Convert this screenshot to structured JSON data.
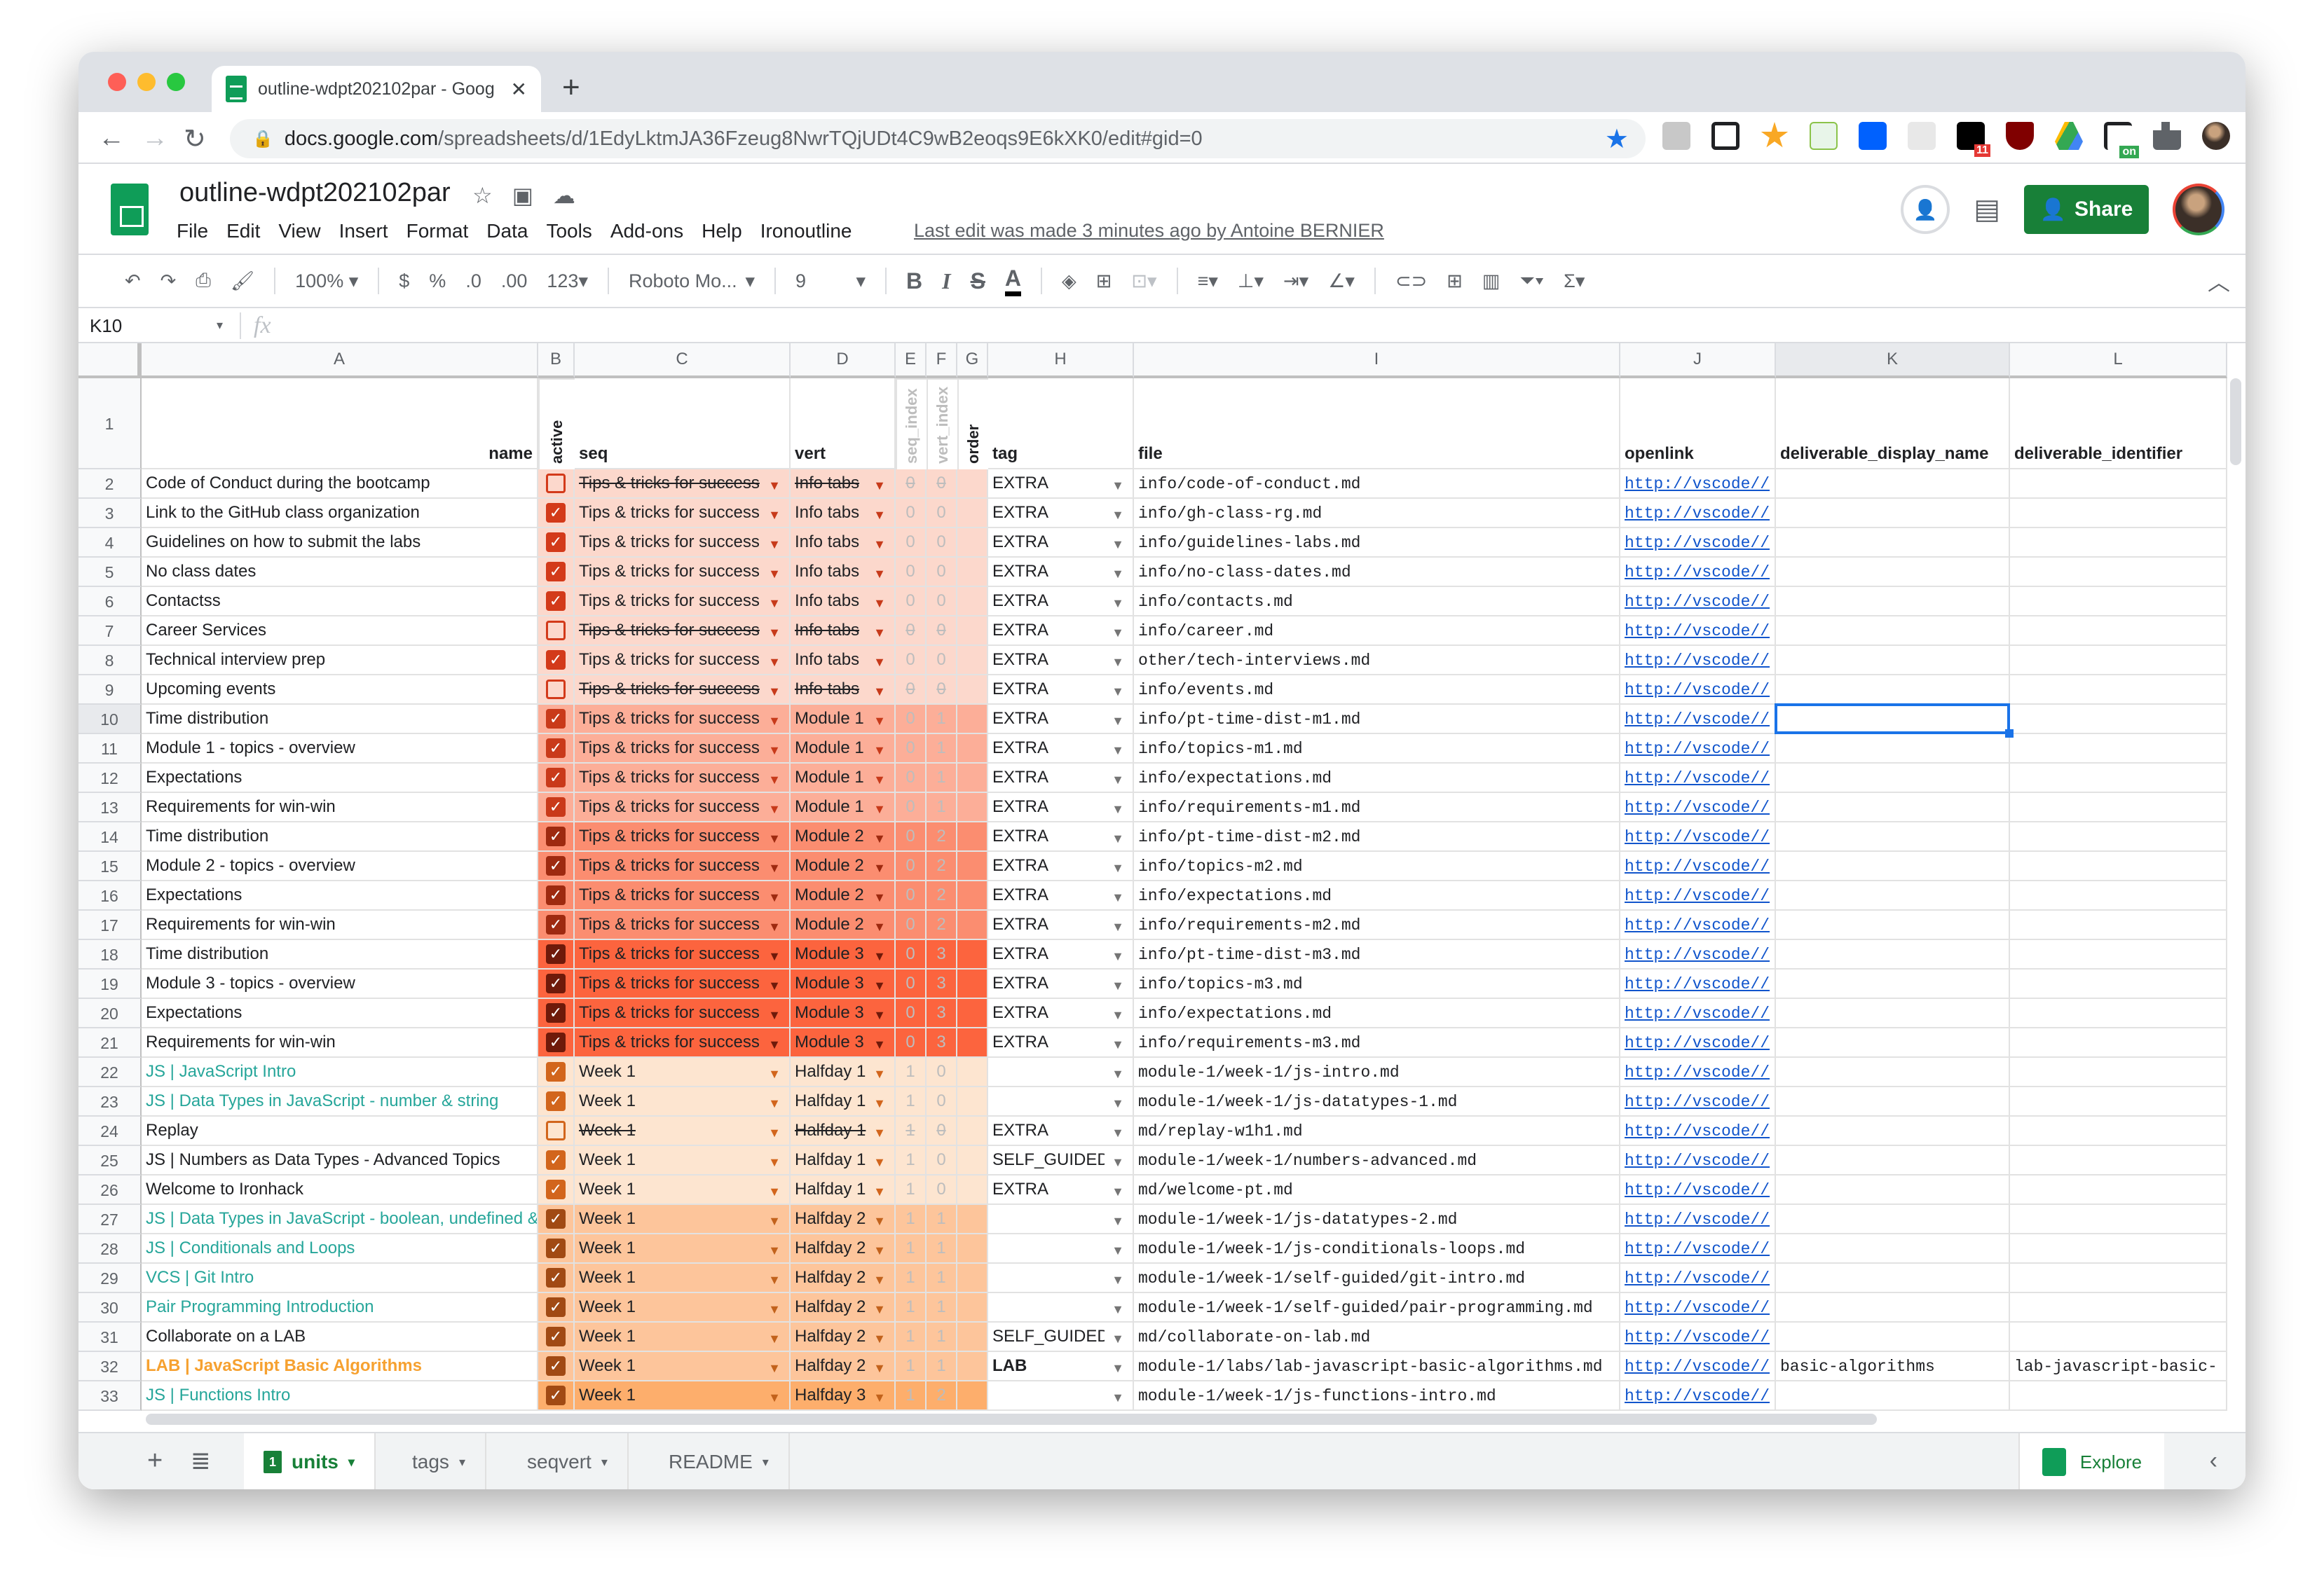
{
  "browser": {
    "tab_title": "outline-wdpt202102par - Goog",
    "url_domain": "docs.google.com",
    "url_path": "/spreadsheets/d/1EdyLktmJA36Fzeug8NwrTQjUDt4C9wB2eoqs9E6kXK0/edit#gid=0",
    "extension_badges": [
      "11",
      "on"
    ]
  },
  "doc": {
    "title": "outline-wdpt202102par",
    "menu": [
      "File",
      "Edit",
      "View",
      "Insert",
      "Format",
      "Data",
      "Tools",
      "Add-ons",
      "Help",
      "Ironoutline"
    ],
    "last_edit": "Last edit was made 3 minutes ago by Antoine BERNIER",
    "share_label": "Share"
  },
  "toolbar": {
    "zoom": "100%",
    "currency": "$",
    "percent": "%",
    "dec_decrease": ".0",
    "dec_increase": ".00",
    "more_formats": "123",
    "font": "Roboto Mo...",
    "font_size": "9"
  },
  "formula_bar": {
    "cell_ref": "K10",
    "fx": "fx",
    "value": ""
  },
  "columns": [
    "A",
    "B",
    "C",
    "D",
    "E",
    "F",
    "G",
    "H",
    "I",
    "J",
    "K",
    "L"
  ],
  "headers": {
    "name": "name",
    "active": "active",
    "seq": "seq",
    "vert": "vert",
    "seq_index": "seq_index",
    "vert_index": "vert_index",
    "order": "order",
    "tag": "tag",
    "file": "file",
    "openlink": "openlink",
    "deliverable_display_name": "deliverable_display_name",
    "deliverable_identifier": "deliverable_identifier"
  },
  "rows": [
    {
      "n": 2,
      "name": "Code of Conduct during the bootcamp",
      "active": false,
      "seq": "Tips & tricks for success",
      "vert": "Info tabs",
      "si": "0",
      "vi": "0",
      "tag": "EXTRA",
      "file": "info/code-of-conduct.md",
      "link": "http://vscode//",
      "band": "t0",
      "nc": "#202124"
    },
    {
      "n": 3,
      "name": "Link to  the GitHub class organization",
      "active": true,
      "seq": "Tips & tricks for success",
      "vert": "Info tabs",
      "si": "0",
      "vi": "0",
      "tag": "EXTRA",
      "file": "info/gh-class-rg.md",
      "link": "http://vscode//",
      "band": "t0",
      "nc": "#202124"
    },
    {
      "n": 4,
      "name": "Guidelines on how to submit the labs",
      "active": true,
      "seq": "Tips & tricks for success",
      "vert": "Info tabs",
      "si": "0",
      "vi": "0",
      "tag": "EXTRA",
      "file": "info/guidelines-labs.md",
      "link": "http://vscode//",
      "band": "t0",
      "nc": "#202124"
    },
    {
      "n": 5,
      "name": "No class dates",
      "active": true,
      "seq": "Tips & tricks for success",
      "vert": "Info tabs",
      "si": "0",
      "vi": "0",
      "tag": "EXTRA",
      "file": "info/no-class-dates.md",
      "link": "http://vscode//",
      "band": "t0",
      "nc": "#202124"
    },
    {
      "n": 6,
      "name": "Contactss",
      "active": true,
      "seq": "Tips & tricks for success",
      "vert": "Info tabs",
      "si": "0",
      "vi": "0",
      "tag": "EXTRA",
      "file": "info/contacts.md",
      "link": "http://vscode//",
      "band": "t0",
      "nc": "#202124"
    },
    {
      "n": 7,
      "name": "Career Services",
      "active": false,
      "seq": "Tips & tricks for success",
      "vert": "Info tabs",
      "si": "0",
      "vi": "0",
      "tag": "EXTRA",
      "file": "info/career.md",
      "link": "http://vscode//",
      "band": "t0",
      "nc": "#202124"
    },
    {
      "n": 8,
      "name": "Technical interview prep",
      "active": true,
      "seq": "Tips & tricks for success",
      "vert": "Info tabs",
      "si": "0",
      "vi": "0",
      "tag": "EXTRA",
      "file": "other/tech-interviews.md",
      "link": "http://vscode//",
      "band": "t0",
      "nc": "#202124"
    },
    {
      "n": 9,
      "name": "Upcoming events",
      "active": false,
      "seq": "Tips & tricks for success",
      "vert": "Info tabs",
      "si": "0",
      "vi": "0",
      "tag": "EXTRA",
      "file": "info/events.md",
      "link": "http://vscode//",
      "band": "t0",
      "nc": "#202124"
    },
    {
      "n": 10,
      "name": "Time distribution",
      "active": true,
      "seq": "Tips & tricks for success",
      "vert": "Module 1",
      "si": "0",
      "vi": "1",
      "tag": "EXTRA",
      "file": "info/pt-time-dist-m1.md",
      "link": "http://vscode//",
      "band": "t1",
      "nc": "#202124"
    },
    {
      "n": 11,
      "name": "Module 1 - topics - overview",
      "active": true,
      "seq": "Tips & tricks for success",
      "vert": "Module 1",
      "si": "0",
      "vi": "1",
      "tag": "EXTRA",
      "file": "info/topics-m1.md",
      "link": "http://vscode//",
      "band": "t1",
      "nc": "#202124"
    },
    {
      "n": 12,
      "name": "Expectations",
      "active": true,
      "seq": "Tips & tricks for success",
      "vert": "Module 1",
      "si": "0",
      "vi": "1",
      "tag": "EXTRA",
      "file": "info/expectations.md",
      "link": "http://vscode//",
      "band": "t1",
      "nc": "#202124"
    },
    {
      "n": 13,
      "name": "Requirements for win-win",
      "active": true,
      "seq": "Tips & tricks for success",
      "vert": "Module 1",
      "si": "0",
      "vi": "1",
      "tag": "EXTRA",
      "file": "info/requirements-m1.md",
      "link": "http://vscode//",
      "band": "t1",
      "nc": "#202124"
    },
    {
      "n": 14,
      "name": "Time distribution",
      "active": true,
      "seq": "Tips & tricks for success",
      "vert": "Module 2",
      "si": "0",
      "vi": "2",
      "tag": "EXTRA",
      "file": "info/pt-time-dist-m2.md",
      "link": "http://vscode//",
      "band": "t2",
      "nc": "#202124"
    },
    {
      "n": 15,
      "name": "Module 2 - topics - overview",
      "active": true,
      "seq": "Tips & tricks for success",
      "vert": "Module 2",
      "si": "0",
      "vi": "2",
      "tag": "EXTRA",
      "file": "info/topics-m2.md",
      "link": "http://vscode//",
      "band": "t2",
      "nc": "#202124"
    },
    {
      "n": 16,
      "name": "Expectations",
      "active": true,
      "seq": "Tips & tricks for success",
      "vert": "Module 2",
      "si": "0",
      "vi": "2",
      "tag": "EXTRA",
      "file": "info/expectations.md",
      "link": "http://vscode//",
      "band": "t2",
      "nc": "#202124"
    },
    {
      "n": 17,
      "name": "Requirements for win-win",
      "active": true,
      "seq": "Tips & tricks for success",
      "vert": "Module 2",
      "si": "0",
      "vi": "2",
      "tag": "EXTRA",
      "file": "info/requirements-m2.md",
      "link": "http://vscode//",
      "band": "t2",
      "nc": "#202124"
    },
    {
      "n": 18,
      "name": "Time distribution",
      "active": true,
      "seq": "Tips & tricks for success",
      "vert": "Module 3",
      "si": "0",
      "vi": "3",
      "tag": "EXTRA",
      "file": "info/pt-time-dist-m3.md",
      "link": "http://vscode//",
      "band": "t3",
      "nc": "#202124"
    },
    {
      "n": 19,
      "name": "Module 3 - topics - overview",
      "active": true,
      "seq": "Tips & tricks for success",
      "vert": "Module 3",
      "si": "0",
      "vi": "3",
      "tag": "EXTRA",
      "file": "info/topics-m3.md",
      "link": "http://vscode//",
      "band": "t3",
      "nc": "#202124"
    },
    {
      "n": 20,
      "name": "Expectations",
      "active": true,
      "seq": "Tips & tricks for success",
      "vert": "Module 3",
      "si": "0",
      "vi": "3",
      "tag": "EXTRA",
      "file": "info/expectations.md",
      "link": "http://vscode//",
      "band": "t3",
      "nc": "#202124"
    },
    {
      "n": 21,
      "name": "Requirements for win-win",
      "active": true,
      "seq": "Tips & tricks for success",
      "vert": "Module 3",
      "si": "0",
      "vi": "3",
      "tag": "EXTRA",
      "file": "info/requirements-m3.md",
      "link": "http://vscode//",
      "band": "t3",
      "nc": "#202124"
    },
    {
      "n": 22,
      "name": "JS | JavaScript Intro",
      "active": true,
      "seq": "Week 1",
      "vert": "Halfday 1",
      "si": "1",
      "vi": "0",
      "tag": "",
      "file": "module-1/week-1/js-intro.md",
      "link": "http://vscode//",
      "band": "w1",
      "nc": "#26a69a"
    },
    {
      "n": 23,
      "name": "JS | Data Types in JavaScript - number & string",
      "active": true,
      "seq": "Week 1",
      "vert": "Halfday 1",
      "si": "1",
      "vi": "0",
      "tag": "",
      "file": "module-1/week-1/js-datatypes-1.md",
      "link": "http://vscode//",
      "band": "w1",
      "nc": "#26a69a"
    },
    {
      "n": 24,
      "name": "Replay",
      "active": false,
      "seq": "Week 1",
      "vert": "Halfday 1",
      "si": "1",
      "vi": "0",
      "tag": "EXTRA",
      "file": "md/replay-w1h1.md",
      "link": "http://vscode//",
      "band": "w1",
      "nc": "#202124"
    },
    {
      "n": 25,
      "name": "JS | Numbers as Data Types - Advanced Topics",
      "active": true,
      "seq": "Week 1",
      "vert": "Halfday 1",
      "si": "1",
      "vi": "0",
      "tag": "SELF_GUIDED",
      "file": "module-1/week-1/numbers-advanced.md",
      "link": "http://vscode//",
      "band": "w1",
      "nc": "#202124"
    },
    {
      "n": 26,
      "name": "Welcome to Ironhack",
      "active": true,
      "seq": "Week 1",
      "vert": "Halfday 1",
      "si": "1",
      "vi": "0",
      "tag": "EXTRA",
      "file": "md/welcome-pt.md",
      "link": "http://vscode//",
      "band": "w1",
      "nc": "#202124"
    },
    {
      "n": 27,
      "name": "JS | Data Types in JavaScript - boolean, undefined &",
      "active": true,
      "seq": "Week 1",
      "vert": "Halfday 2",
      "si": "1",
      "vi": "1",
      "tag": "",
      "file": "module-1/week-1/js-datatypes-2.md",
      "link": "http://vscode//",
      "band": "w2",
      "nc": "#26a69a"
    },
    {
      "n": 28,
      "name": "JS | Conditionals and Loops",
      "active": true,
      "seq": "Week 1",
      "vert": "Halfday 2",
      "si": "1",
      "vi": "1",
      "tag": "",
      "file": "module-1/week-1/js-conditionals-loops.md",
      "link": "http://vscode//",
      "band": "w2",
      "nc": "#26a69a"
    },
    {
      "n": 29,
      "name": "VCS | Git Intro",
      "active": true,
      "seq": "Week 1",
      "vert": "Halfday 2",
      "si": "1",
      "vi": "1",
      "tag": "",
      "file": "module-1/week-1/self-guided/git-intro.md",
      "link": "http://vscode//",
      "band": "w2",
      "nc": "#26a69a"
    },
    {
      "n": 30,
      "name": "Pair Programming Introduction",
      "active": true,
      "seq": "Week 1",
      "vert": "Halfday 2",
      "si": "1",
      "vi": "1",
      "tag": "",
      "file": "module-1/week-1/self-guided/pair-programming.md",
      "link": "http://vscode//",
      "band": "w2",
      "nc": "#26a69a"
    },
    {
      "n": 31,
      "name": "Collaborate on a LAB",
      "active": true,
      "seq": "Week 1",
      "vert": "Halfday 2",
      "si": "1",
      "vi": "1",
      "tag": "SELF_GUIDED",
      "file": "md/collaborate-on-lab.md",
      "link": "http://vscode//",
      "band": "w2",
      "nc": "#202124"
    },
    {
      "n": 32,
      "name": "LAB | JavaScript Basic Algorithms",
      "active": true,
      "seq": "Week 1",
      "vert": "Halfday 2",
      "si": "1",
      "vi": "1",
      "tag": "LAB",
      "file": "module-1/labs/lab-javascript-basic-algorithms.md",
      "link": "http://vscode//",
      "dname": "basic-algorithms",
      "did": "lab-javascript-basic-",
      "band": "w2",
      "nc": "#f6a130",
      "bold": true
    },
    {
      "n": 33,
      "name": "JS | Functions Intro",
      "active": true,
      "seq": "Week 1",
      "vert": "Halfday 3",
      "si": "1",
      "vi": "2",
      "tag": "",
      "file": "module-1/week-1/js-functions-intro.md",
      "link": "http://vscode//",
      "band": "w3",
      "nc": "#26a69a"
    }
  ],
  "bands": {
    "t0": {
      "bg": "#fcd8cc",
      "cb": "#d33a1a",
      "txt": "#c73a1a"
    },
    "t1": {
      "bg": "#fcae98",
      "cb": "#c93a1a",
      "txt": "#c73a1a"
    },
    "t2": {
      "bg": "#fb8d70",
      "cb": "#9e2a10",
      "txt": "#9e2a10"
    },
    "t3": {
      "bg": "#fc643e",
      "cb": "#6f1a0a",
      "txt": "#6f1a0a"
    },
    "w1": {
      "bg": "#fde5d0",
      "cb": "#d2651c",
      "txt": "#d2651c"
    },
    "w2": {
      "bg": "#fdc59b",
      "cb": "#a14a14",
      "txt": "#c2621c"
    },
    "w3": {
      "bg": "#fdae6c",
      "cb": "#a14a14",
      "txt": "#c2621c"
    }
  },
  "selected_cell": "K10",
  "sheet_tabs": [
    {
      "label": "units",
      "active": true,
      "badge": "1"
    },
    {
      "label": "tags",
      "active": false
    },
    {
      "label": "seqvert",
      "active": false
    },
    {
      "label": "README",
      "active": false
    }
  ],
  "explore_label": "Explore"
}
